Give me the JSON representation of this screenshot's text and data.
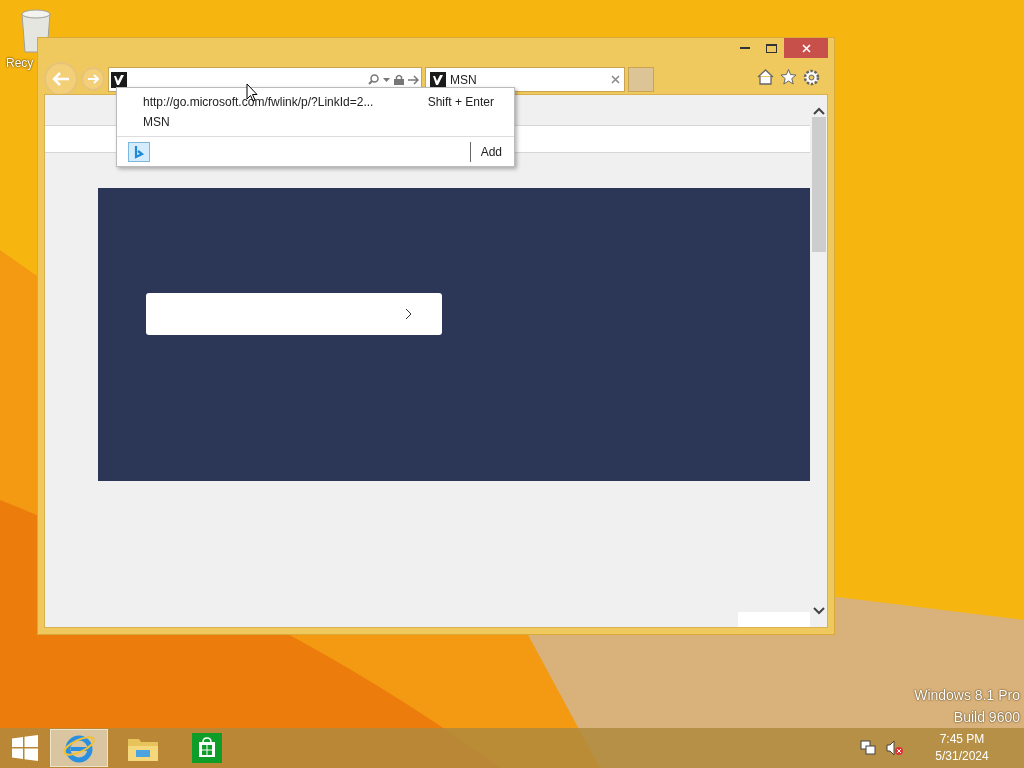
{
  "desktop": {
    "icons": [
      {
        "label": "Recy"
      }
    ]
  },
  "browser": {
    "tabs": [
      {
        "title": "MSN",
        "selected": true
      }
    ],
    "address_dropdown": {
      "suggestions": [
        {
          "text": "http://go.microsoft.com/fwlink/p/?LinkId=2...",
          "shortcut": "Shift + Enter"
        },
        {
          "text": "MSN"
        }
      ],
      "add_label": "Add"
    }
  },
  "watermark": [
    "Windows 8.1 Pro",
    "Build 9600"
  ],
  "taskbar": {
    "apps": [
      {
        "kind": "ie",
        "selected": true
      },
      {
        "kind": "explorer",
        "selected": false
      },
      {
        "kind": "store",
        "selected": false
      }
    ],
    "tray": {
      "time": "7:45 PM",
      "date": "5/31/2024"
    }
  }
}
